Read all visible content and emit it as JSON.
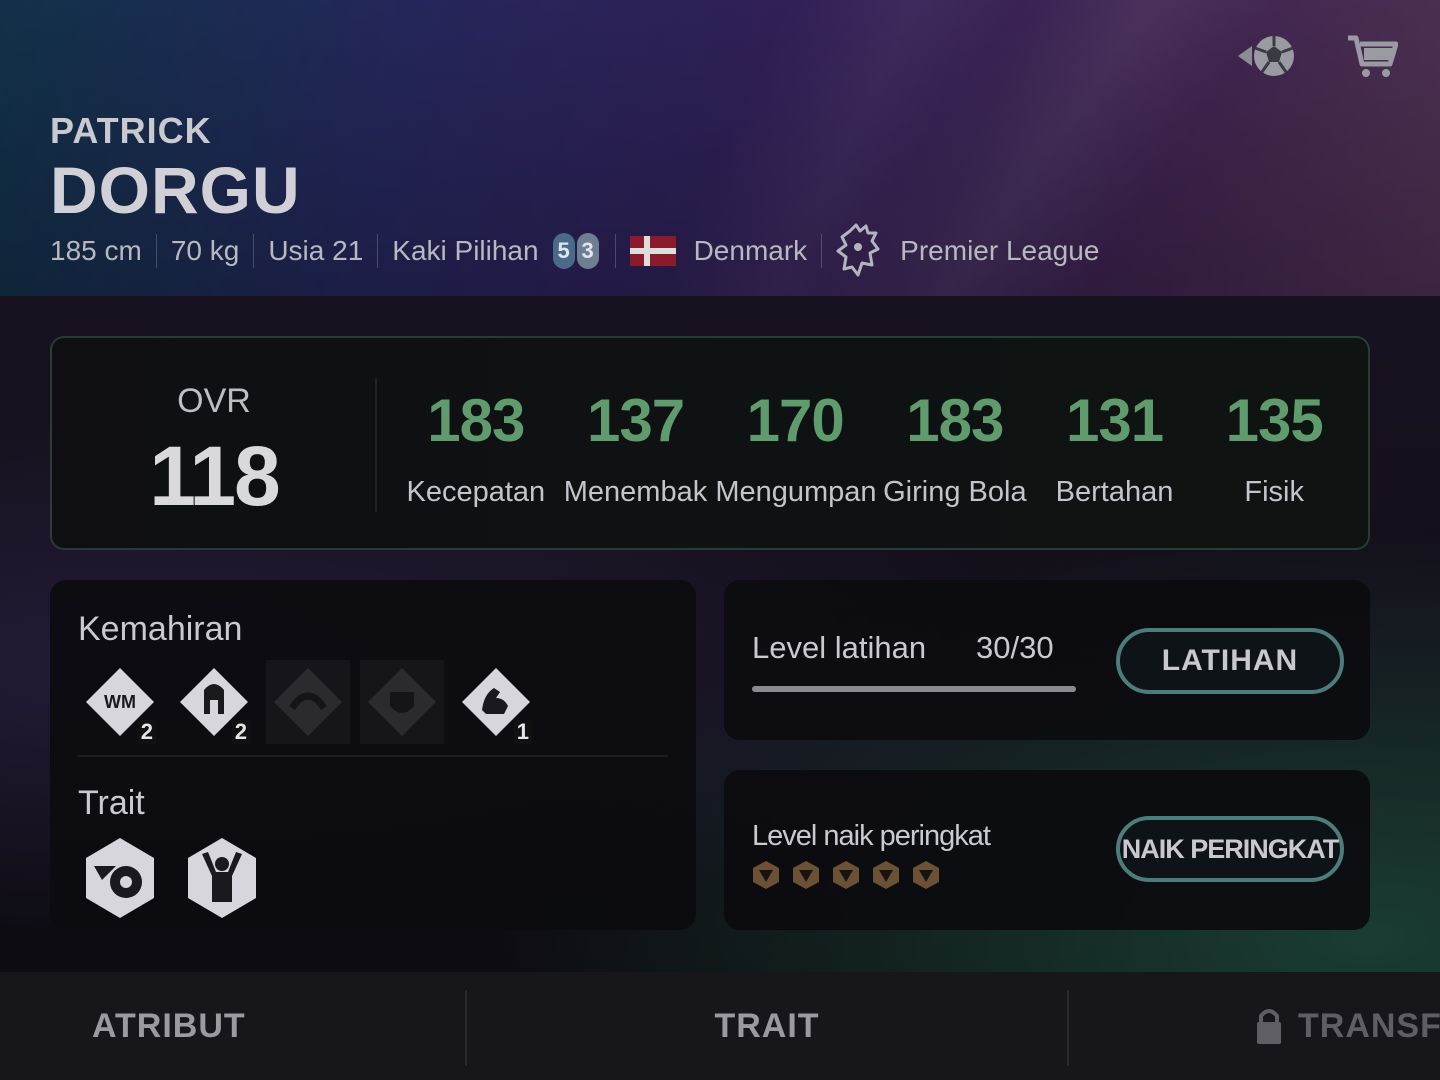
{
  "player": {
    "first_name": "PATRICK",
    "last_name": "DORGU",
    "height": "185 cm",
    "weight": "70 kg",
    "age": "Usia 21",
    "preferred_foot_label": "Kaki Pilihan",
    "foot_left": "5",
    "foot_right": "3",
    "nation": "Denmark",
    "league": "Premier League"
  },
  "icons": {
    "top": [
      "football-icon",
      "cart-icon"
    ],
    "flag": "denmark-flag-icon",
    "league": "premier-league-lion-icon"
  },
  "ratings": {
    "ovr_label": "OVR",
    "ovr_value": "118",
    "stats": [
      {
        "value": "183",
        "label": "Kecepatan"
      },
      {
        "value": "137",
        "label": "Menembak"
      },
      {
        "value": "170",
        "label": "Mengumpan"
      },
      {
        "value": "183",
        "label": "Giring Bola"
      },
      {
        "value": "131",
        "label": "Bertahan"
      },
      {
        "value": "135",
        "label": "Fisik"
      }
    ]
  },
  "skills": {
    "title": "Kemahiran",
    "badges": [
      {
        "icon": "wm-badge-icon",
        "text": "WM",
        "level": "2",
        "locked": false
      },
      {
        "icon": "spartan-helmet-badge-icon",
        "level": "2",
        "locked": false
      },
      {
        "icon": "curve-badge-icon",
        "locked": true
      },
      {
        "icon": "shield-badge-icon",
        "locked": true
      },
      {
        "icon": "flexed-arm-badge-icon",
        "level": "1",
        "locked": false
      }
    ],
    "trait_title": "Trait",
    "traits": [
      "power-shot-trait-icon",
      "celebration-trait-icon"
    ]
  },
  "training": {
    "label": "Level latihan",
    "value": "30/30",
    "progress": 1.0,
    "button": "LATIHAN"
  },
  "rankup": {
    "label": "Level naik peringkat",
    "stars_total": 5,
    "button": "NAIK PERINGKAT"
  },
  "tabs": [
    {
      "label": "ATRIBUT"
    },
    {
      "label": "TRAIT"
    },
    {
      "label": "TRANSF",
      "locked": true
    }
  ],
  "colors": {
    "stat_green": "#5f9b6c",
    "button_border": "#4c7d7a"
  }
}
